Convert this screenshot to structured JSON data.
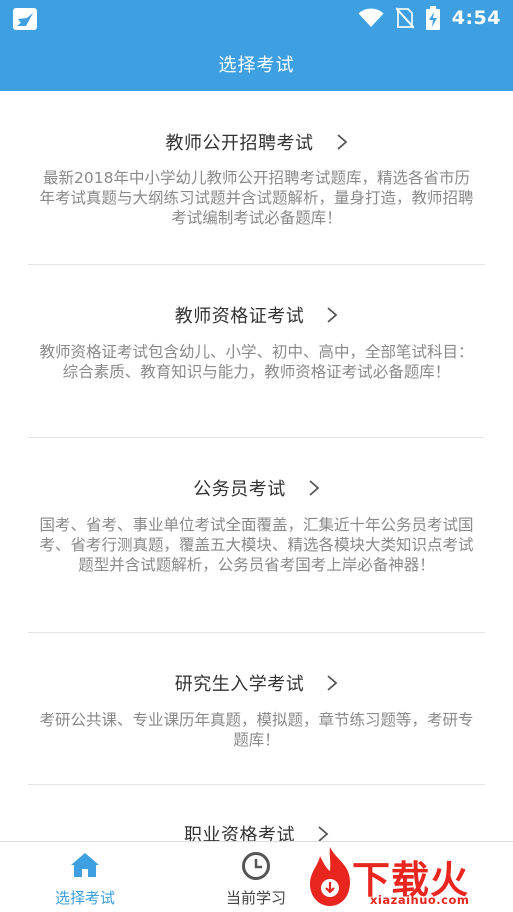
{
  "status_bar": {
    "time": "4:54"
  },
  "header": {
    "title": "选择考试"
  },
  "exams": [
    {
      "title": "教师公开招聘考试",
      "description": "最新2018年中小学幼儿教师公开招聘考试题库，精选各省市历年考试真题与大纲练习试题并含试题解析，量身打造，教师招聘考试编制考试必备题库！"
    },
    {
      "title": "教师资格证考试",
      "description": "教师资格证考试包含幼儿、小学、初中、高中，全部笔试科目：综合素质、教育知识与能力，教师资格证考试必备题库！"
    },
    {
      "title": "公务员考试",
      "description": "国考、省考、事业单位考试全面覆盖，汇集近十年公务员考试国考、省考行测真题，覆盖五大模块、精选各模块大类知识点考试题型并含试题解析，公务员省考国考上岸必备神器！"
    },
    {
      "title": "研究生入学考试",
      "description": "考研公共课、专业课历年真题，模拟题，章节练习题等，考研专题库！"
    },
    {
      "title": "职业资格考试",
      "description": ""
    }
  ],
  "tabs": [
    {
      "label": "选择考试",
      "icon": "home-icon"
    },
    {
      "label": "当前学习",
      "icon": "clock-icon"
    }
  ],
  "watermark": {
    "brand": "下载火",
    "url": "xiazaihuo.com"
  },
  "colors": {
    "primary": "#3ea0e0",
    "watermark_red": "#e8251f"
  }
}
